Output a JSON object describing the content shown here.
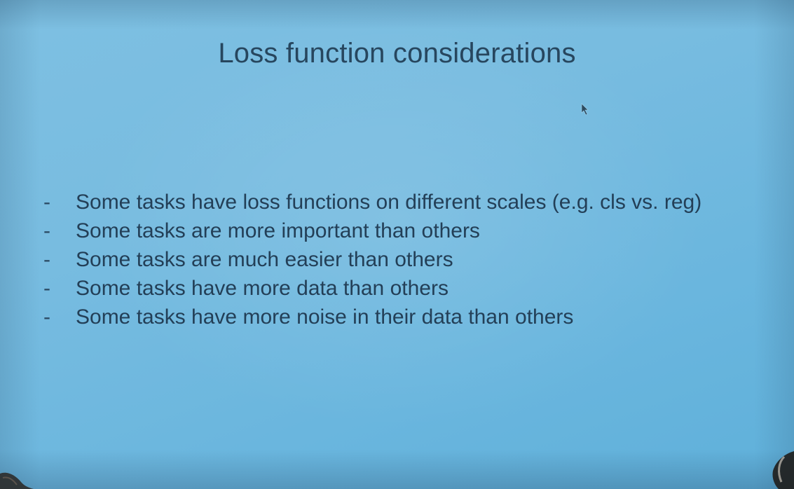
{
  "slide": {
    "title": "Loss function considerations",
    "bullet_marker": "-",
    "bullets": [
      "Some tasks have loss functions on different scales (e.g. cls vs. reg)",
      "Some tasks are more important than others",
      "Some tasks are much easier than others",
      "Some tasks have more data than others",
      "Some tasks have more noise in their data than others"
    ]
  },
  "colors": {
    "slide_background": "#72b9df",
    "text": "#233f57"
  },
  "icons": {
    "pointer": "mouse-cursor-icon"
  }
}
